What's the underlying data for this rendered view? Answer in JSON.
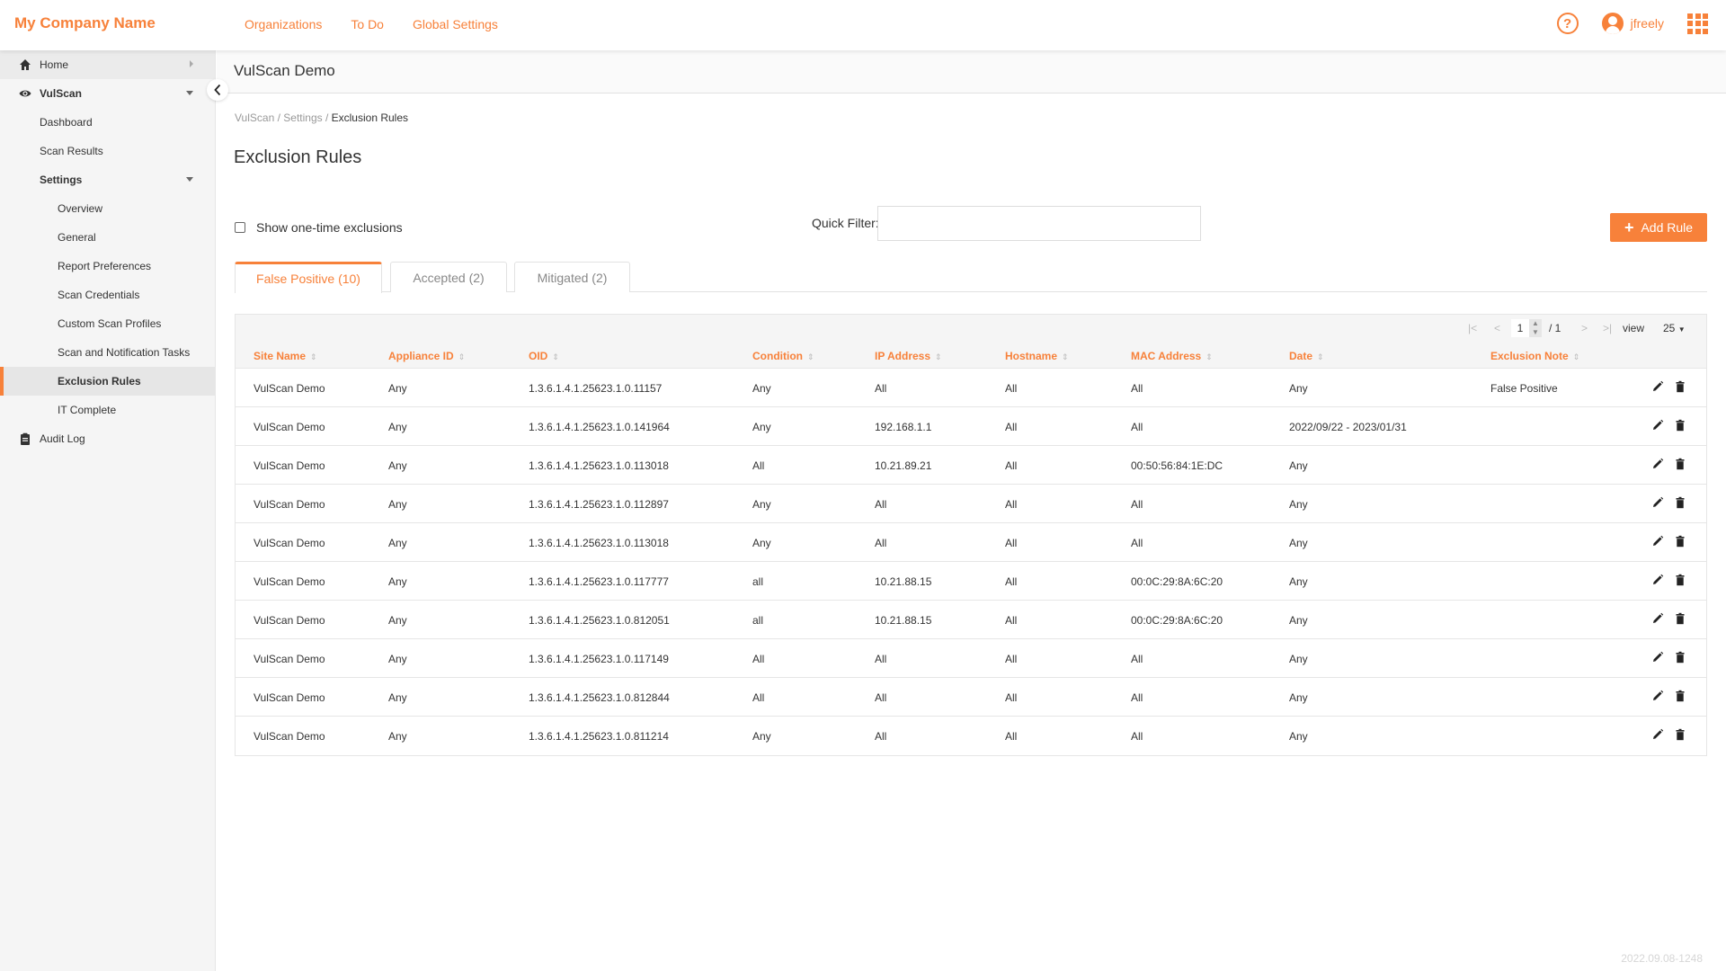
{
  "brand": "My Company Name",
  "topnav": [
    "Organizations",
    "To Do",
    "Global Settings"
  ],
  "user": {
    "name": "jfreely",
    "help_icon": "help-circle-icon",
    "avatar_icon": "account-circle-icon",
    "apps_icon": "apps-grid-icon"
  },
  "colors": {
    "accent": "#f7813a",
    "sidebar_bg": "#f5f5f5",
    "text": "#333333"
  },
  "sidebar": {
    "items": [
      {
        "label": "Home",
        "icon": "home-icon",
        "level": 0
      },
      {
        "label": "VulScan",
        "icon": "eye-icon",
        "level": 0
      },
      {
        "label": "Dashboard",
        "level": 1
      },
      {
        "label": "Scan Results",
        "level": 1
      },
      {
        "label": "Settings",
        "level": 1
      },
      {
        "label": "Overview",
        "level": 2
      },
      {
        "label": "General",
        "level": 2
      },
      {
        "label": "Report Preferences",
        "level": 2
      },
      {
        "label": "Scan Credentials",
        "level": 2
      },
      {
        "label": "Custom Scan Profiles",
        "level": 2
      },
      {
        "label": "Scan and Notification Tasks",
        "level": 2
      },
      {
        "label": "Exclusion Rules",
        "level": 2,
        "active": true
      },
      {
        "label": "IT Complete",
        "level": 2
      },
      {
        "label": "Audit Log",
        "icon": "clipboard-icon",
        "level": 0
      }
    ]
  },
  "page_header": "VulScan Demo",
  "breadcrumb": {
    "parts": [
      "VulScan",
      "Settings"
    ],
    "sep": " / ",
    "current": "Exclusion Rules"
  },
  "title": "Exclusion Rules",
  "filters": {
    "show_one_time_label": "Show one-time exclusions",
    "show_one_time_checked": false,
    "quick_filter_label": "Quick Filter:",
    "quick_filter_value": ""
  },
  "add_button": {
    "icon": "+",
    "label": "Add Rule"
  },
  "tabs": [
    {
      "label": "False Positive (10)",
      "active": true
    },
    {
      "label": "Accepted (2)",
      "active": false
    },
    {
      "label": "Mitigated (2)",
      "active": false
    }
  ],
  "pager": {
    "first": "|<",
    "prev": "<",
    "page": "1",
    "total": "/ 1",
    "next": ">",
    "last": ">|",
    "view_label": "view",
    "page_size": "25"
  },
  "table": {
    "columns": [
      "Site Name",
      "Appliance ID",
      "OID",
      "Condition",
      "IP Address",
      "Hostname",
      "MAC Address",
      "Date",
      "Exclusion Note"
    ],
    "rows": [
      [
        "VulScan Demo",
        "Any",
        "1.3.6.1.4.1.25623.1.0.11157",
        "Any",
        "All",
        "All",
        "All",
        "Any",
        "False Positive"
      ],
      [
        "VulScan Demo",
        "Any",
        "1.3.6.1.4.1.25623.1.0.141964",
        "Any",
        "192.168.1.1",
        "All",
        "All",
        "2022/09/22 - 2023/01/31",
        ""
      ],
      [
        "VulScan Demo",
        "Any",
        "1.3.6.1.4.1.25623.1.0.113018",
        "All",
        "10.21.89.21",
        "All",
        "00:50:56:84:1E:DC",
        "Any",
        ""
      ],
      [
        "VulScan Demo",
        "Any",
        "1.3.6.1.4.1.25623.1.0.112897",
        "Any",
        "All",
        "All",
        "All",
        "Any",
        ""
      ],
      [
        "VulScan Demo",
        "Any",
        "1.3.6.1.4.1.25623.1.0.113018",
        "Any",
        "All",
        "All",
        "All",
        "Any",
        ""
      ],
      [
        "VulScan Demo",
        "Any",
        "1.3.6.1.4.1.25623.1.0.117777",
        "all",
        "10.21.88.15",
        "All",
        "00:0C:29:8A:6C:20",
        "Any",
        ""
      ],
      [
        "VulScan Demo",
        "Any",
        "1.3.6.1.4.1.25623.1.0.812051",
        "all",
        "10.21.88.15",
        "All",
        "00:0C:29:8A:6C:20",
        "Any",
        ""
      ],
      [
        "VulScan Demo",
        "Any",
        "1.3.6.1.4.1.25623.1.0.117149",
        "All",
        "All",
        "All",
        "All",
        "Any",
        ""
      ],
      [
        "VulScan Demo",
        "Any",
        "1.3.6.1.4.1.25623.1.0.812844",
        "All",
        "All",
        "All",
        "All",
        "Any",
        ""
      ],
      [
        "VulScan Demo",
        "Any",
        "1.3.6.1.4.1.25623.1.0.811214",
        "Any",
        "All",
        "All",
        "All",
        "Any",
        ""
      ]
    ],
    "row_actions": [
      "edit-icon",
      "delete-icon"
    ]
  },
  "version": "2022.09.08-1248"
}
